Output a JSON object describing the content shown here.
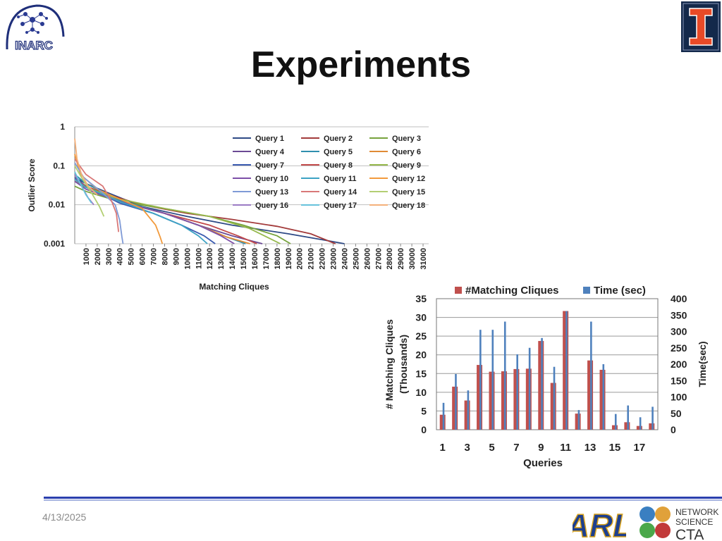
{
  "slide": {
    "title": "Experiments",
    "date": "4/13/2025",
    "logo_left_text": "INARC",
    "logo_right_org": "ARL",
    "logo_right_text": [
      "NETWORK",
      "SCIENCE",
      "CTA"
    ],
    "colors": {
      "accent_line": "#2b3fae",
      "uiuc_blue": "#13294b",
      "uiuc_orange": "#e84a27"
    }
  },
  "chart_data": [
    {
      "type": "line",
      "title": "",
      "xlabel": "Matching Cliques",
      "ylabel": "Outlier Score",
      "y_scale": "log",
      "ylim": [
        0.001,
        1
      ],
      "y_ticks": [
        "1",
        "0.1",
        "0.01",
        "0.001"
      ],
      "x_ticks": [
        "1000",
        "2000",
        "3000",
        "4000",
        "5000",
        "6000",
        "7000",
        "8000",
        "9000",
        "10000",
        "11000",
        "12000",
        "13000",
        "14000",
        "15000",
        "16000",
        "17000",
        "18000",
        "19000",
        "20000",
        "21000",
        "22000",
        "23000",
        "24000",
        "25000",
        "26000",
        "27000",
        "28000",
        "29000",
        "30000",
        "31000"
      ],
      "xlim": [
        0,
        31500
      ],
      "legend_position": "top-right",
      "grid": true,
      "series": [
        {
          "name": "Query 1",
          "color": "#2e4a86",
          "points": [
            [
              0,
              0.05
            ],
            [
              1000,
              0.035
            ],
            [
              3000,
              0.02
            ],
            [
              6000,
              0.009
            ],
            [
              10000,
              0.005
            ],
            [
              14000,
              0.003
            ],
            [
              19000,
              0.0018
            ],
            [
              22500,
              0.0012
            ],
            [
              24000,
              0.001
            ]
          ]
        },
        {
          "name": "Query 2",
          "color": "#a33b3b",
          "points": [
            [
              0,
              0.04
            ],
            [
              1000,
              0.03
            ],
            [
              3000,
              0.018
            ],
            [
              6000,
              0.01
            ],
            [
              10000,
              0.006
            ],
            [
              14000,
              0.0042
            ],
            [
              18000,
              0.0028
            ],
            [
              21000,
              0.0018
            ],
            [
              23200,
              0.001
            ]
          ]
        },
        {
          "name": "Query 3",
          "color": "#77a33d",
          "points": [
            [
              0,
              0.03
            ],
            [
              1000,
              0.022
            ],
            [
              4000,
              0.012
            ],
            [
              8000,
              0.008
            ],
            [
              12000,
              0.005
            ],
            [
              15000,
              0.003
            ],
            [
              18000,
              0.0016
            ],
            [
              19200,
              0.001
            ]
          ]
        },
        {
          "name": "Query 4",
          "color": "#6b4a94",
          "points": [
            [
              0,
              0.04
            ],
            [
              1000,
              0.028
            ],
            [
              4000,
              0.012
            ],
            [
              8000,
              0.006
            ],
            [
              11000,
              0.003
            ],
            [
              14000,
              0.0016
            ],
            [
              16700,
              0.001
            ]
          ]
        },
        {
          "name": "Query 5",
          "color": "#2f8fae",
          "points": [
            [
              0,
              0.06
            ],
            [
              1000,
              0.035
            ],
            [
              4000,
              0.013
            ],
            [
              8000,
              0.006
            ],
            [
              11000,
              0.003
            ],
            [
              13500,
              0.0015
            ],
            [
              15200,
              0.001
            ]
          ]
        },
        {
          "name": "Query 6",
          "color": "#e08a35",
          "points": [
            [
              0,
              0.05
            ],
            [
              1000,
              0.03
            ],
            [
              4000,
              0.012
            ],
            [
              8000,
              0.006
            ],
            [
              11000,
              0.003
            ],
            [
              13500,
              0.0015
            ],
            [
              15600,
              0.001
            ]
          ]
        },
        {
          "name": "Query 7",
          "color": "#3b5bb0",
          "points": [
            [
              0,
              0.05
            ],
            [
              1000,
              0.03
            ],
            [
              4000,
              0.011
            ],
            [
              7000,
              0.006
            ],
            [
              9500,
              0.003
            ],
            [
              11500,
              0.0016
            ],
            [
              12500,
              0.001
            ]
          ]
        },
        {
          "name": "Query 8",
          "color": "#c24a4a",
          "points": [
            [
              0,
              0.045
            ],
            [
              1000,
              0.03
            ],
            [
              4000,
              0.012
            ],
            [
              8000,
              0.006
            ],
            [
              12000,
              0.003
            ],
            [
              14500,
              0.0016
            ],
            [
              16200,
              0.001
            ]
          ]
        },
        {
          "name": "Query 9",
          "color": "#95b84b",
          "points": [
            [
              0,
              0.04
            ],
            [
              1000,
              0.028
            ],
            [
              4000,
              0.014
            ],
            [
              8000,
              0.008
            ],
            [
              12000,
              0.005
            ],
            [
              15500,
              0.0025
            ],
            [
              17500,
              0.0013
            ],
            [
              18300,
              0.001
            ]
          ]
        },
        {
          "name": "Query 10",
          "color": "#7d4fa8",
          "points": [
            [
              0,
              0.04
            ],
            [
              1000,
              0.025
            ],
            [
              4000,
              0.012
            ],
            [
              8000,
              0.006
            ],
            [
              11000,
              0.003
            ],
            [
              13000,
              0.0016
            ],
            [
              14200,
              0.001
            ]
          ]
        },
        {
          "name": "Query 11",
          "color": "#3ca2c4",
          "points": [
            [
              0,
              0.045
            ],
            [
              1000,
              0.028
            ],
            [
              4000,
              0.012
            ],
            [
              7000,
              0.006
            ],
            [
              9500,
              0.003
            ],
            [
              11000,
              0.0016
            ],
            [
              11800,
              0.001
            ]
          ]
        },
        {
          "name": "Query 12",
          "color": "#f29a3c",
          "points": [
            [
              0,
              0.2
            ],
            [
              500,
              0.06
            ],
            [
              2000,
              0.025
            ],
            [
              4000,
              0.014
            ],
            [
              6000,
              0.008
            ],
            [
              7200,
              0.003
            ],
            [
              7600,
              0.0015
            ],
            [
              7800,
              0.001
            ]
          ]
        },
        {
          "name": "Query 13",
          "color": "#7f9ad6",
          "points": [
            [
              0,
              0.12
            ],
            [
              800,
              0.05
            ],
            [
              2500,
              0.02
            ],
            [
              3600,
              0.01
            ],
            [
              4000,
              0.004
            ],
            [
              4200,
              0.0015
            ],
            [
              4300,
              0.001
            ]
          ]
        },
        {
          "name": "Query 14",
          "color": "#d97878",
          "points": [
            [
              0,
              0.15
            ],
            [
              1000,
              0.06
            ],
            [
              2500,
              0.03
            ],
            [
              3300,
              0.012
            ],
            [
              3700,
              0.006
            ],
            [
              3900,
              0.002
            ]
          ]
        },
        {
          "name": "Query 15",
          "color": "#b3cf73",
          "points": [
            [
              0,
              0.1
            ],
            [
              600,
              0.05
            ],
            [
              1500,
              0.02
            ],
            [
              2200,
              0.009
            ],
            [
              2600,
              0.005
            ]
          ]
        },
        {
          "name": "Query 16",
          "color": "#9b7bc4",
          "points": [
            [
              0,
              0.06
            ],
            [
              600,
              0.03
            ],
            [
              1200,
              0.015
            ],
            [
              1700,
              0.01
            ]
          ]
        },
        {
          "name": "Query 17",
          "color": "#67c2dc",
          "points": [
            [
              0,
              0.07
            ],
            [
              400,
              0.04
            ],
            [
              1000,
              0.018
            ],
            [
              1500,
              0.011
            ]
          ]
        },
        {
          "name": "Query 18",
          "color": "#f4b07a",
          "points": [
            [
              0,
              0.5
            ],
            [
              200,
              0.15
            ],
            [
              600,
              0.06
            ],
            [
              1200,
              0.03
            ],
            [
              2000,
              0.018
            ]
          ]
        }
      ]
    },
    {
      "type": "bar",
      "title": "",
      "xlabel": "Queries",
      "ylabel": "# Matching Cliques (Thousands)",
      "ylabel_lines": [
        "# Matching Cliques",
        "(Thousands)"
      ],
      "y2label": "Time(sec)",
      "ylim": [
        0,
        35
      ],
      "y2lim": [
        0,
        400
      ],
      "y_ticks": [
        "0",
        "5",
        "10",
        "15",
        "20",
        "25",
        "30",
        "35"
      ],
      "y2_ticks": [
        "0",
        "50",
        "100",
        "150",
        "200",
        "250",
        "300",
        "350",
        "400"
      ],
      "x_tick_labels": [
        "1",
        "3",
        "5",
        "7",
        "9",
        "11",
        "13",
        "15",
        "17"
      ],
      "legend_position": "top",
      "grid": true,
      "categories": [
        "1",
        "2",
        "3",
        "4",
        "5",
        "6",
        "7",
        "8",
        "9",
        "10",
        "11",
        "12",
        "13",
        "14",
        "15",
        "16",
        "17",
        "18"
      ],
      "series": [
        {
          "name": "#Matching Cliques",
          "axis": "left",
          "color": "#c0504d",
          "values": [
            4,
            11.5,
            7.8,
            17.3,
            15.5,
            15.6,
            16.2,
            16.3,
            23.7,
            12.5,
            31.7,
            4.3,
            18.5,
            16,
            1.2,
            2,
            1,
            1.7
          ]
        },
        {
          "name": "Time (sec)",
          "axis": "right",
          "color": "#4f81bd",
          "values": [
            82,
            170,
            120,
            305,
            305,
            330,
            230,
            250,
            280,
            192,
            362,
            60,
            330,
            200,
            48,
            74,
            38,
            70
          ]
        }
      ]
    }
  ]
}
